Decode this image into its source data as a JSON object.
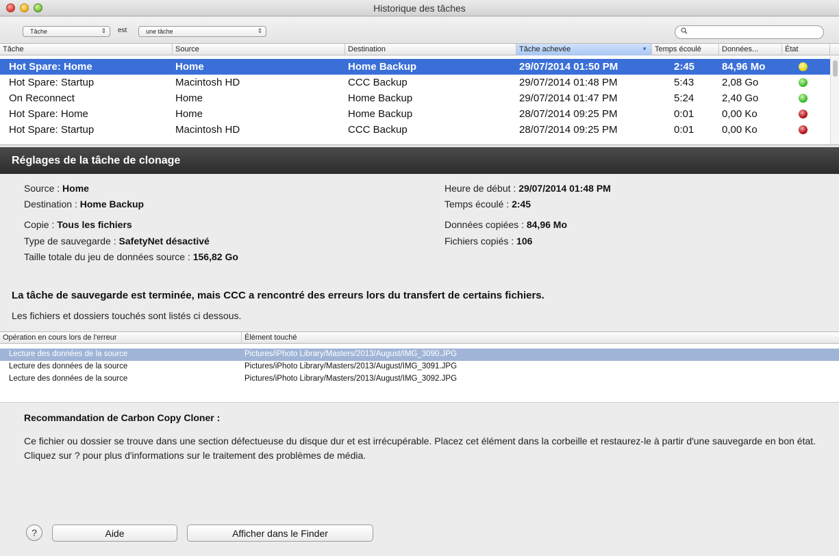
{
  "window": {
    "title": "Historique des tâches",
    "controls": [
      "close",
      "minimize",
      "zoom"
    ]
  },
  "filter": {
    "field": "Tâche",
    "operator": "est",
    "value": "une tâche",
    "search_placeholder": "",
    "search_icon": "magnifier-icon"
  },
  "task_table": {
    "columns": [
      "Tâche",
      "Source",
      "Destination",
      "Tâche achevée",
      "Temps écoulé",
      "Données...",
      "État"
    ],
    "sorted_column": "Tâche achevée",
    "sort_direction": "descending",
    "rows": [
      {
        "task": "Hot Spare: Home",
        "source": "Home",
        "destination": "Home Backup",
        "completed": "29/07/2014 01:50 PM",
        "elapsed": "2:45",
        "data": "84,96 Mo",
        "status": "yellow",
        "selected": true
      },
      {
        "task": "Hot Spare: Startup",
        "source": "Macintosh HD",
        "destination": "CCC Backup",
        "completed": "29/07/2014 01:48 PM",
        "elapsed": "5:43",
        "data": "2,08 Go",
        "status": "green",
        "selected": false
      },
      {
        "task": "On Reconnect",
        "source": "Home",
        "destination": "Home Backup",
        "completed": "29/07/2014 01:47 PM",
        "elapsed": "5:24",
        "data": "2,40 Go",
        "status": "green",
        "selected": false
      },
      {
        "task": "Hot Spare: Home",
        "source": "Home",
        "destination": "Home Backup",
        "completed": "28/07/2014 09:25 PM",
        "elapsed": "0:01",
        "data": "0,00 Ko",
        "status": "red",
        "selected": false
      },
      {
        "task": "Hot Spare: Startup",
        "source": "Macintosh HD",
        "destination": "CCC Backup",
        "completed": "28/07/2014 09:25 PM",
        "elapsed": "0:01",
        "data": "0,00 Ko",
        "status": "red",
        "selected": false
      }
    ]
  },
  "status_colors": {
    "yellow": "#e6d81c",
    "green": "#3fbf2f",
    "red": "#b3161c"
  },
  "settings": {
    "header": "Réglages de la tâche de clonage",
    "source_label": "Source :",
    "source_value": "Home",
    "destination_label": "Destination :",
    "destination_value": "Home Backup",
    "copy_label": "Copie :",
    "copy_value": "Tous les fichiers",
    "backup_type_label": "Type de sauvegarde :",
    "backup_type_value": "SafetyNet désactivé",
    "total_size_label": "Taille totale du jeu de données source :",
    "total_size_value": "156,82 Go",
    "start_label": "Heure de début :",
    "start_value": "29/07/2014 01:48 PM",
    "elapsed_label": "Temps écoulé :",
    "elapsed_value": "2:45",
    "data_copied_label": "Données copiées :",
    "data_copied_value": "84,96 Mo",
    "files_copied_label": "Fichiers copiés :",
    "files_copied_value": "106"
  },
  "errors": {
    "message": "La tâche de sauvegarde est terminée, mais CCC a rencontré des erreurs lors du transfert de certains fichiers.",
    "sub_message": "Les fichiers et dossiers touchés sont listés ci dessous.",
    "columns": [
      "Opération en cours lors de l'erreur",
      "Élément touché"
    ],
    "rows": [
      {
        "operation": "Lecture des données de la source",
        "item": "Pictures/iPhoto Library/Masters/2013/August/IMG_3090.JPG",
        "selected": true
      },
      {
        "operation": "Lecture des données de la source",
        "item": "Pictures/iPhoto Library/Masters/2013/August/IMG_3091.JPG",
        "selected": false
      },
      {
        "operation": "Lecture des données de la source",
        "item": "Pictures/iPhoto Library/Masters/2013/August/IMG_3092.JPG",
        "selected": false
      }
    ]
  },
  "recommendation": {
    "title": "Recommandation de Carbon Copy Cloner :",
    "text": "Ce fichier ou dossier se trouve dans une section défectueuse du disque dur et est irrécupérable. Placez cet élément dans la corbeille et restaurez-le à partir d'une sauvegarde en bon état. Cliquez sur ? pour plus d'informations sur le traitement des problèmes de média."
  },
  "buttons": {
    "help_icon": "?",
    "aide": "Aide",
    "finder": "Afficher dans le Finder"
  }
}
